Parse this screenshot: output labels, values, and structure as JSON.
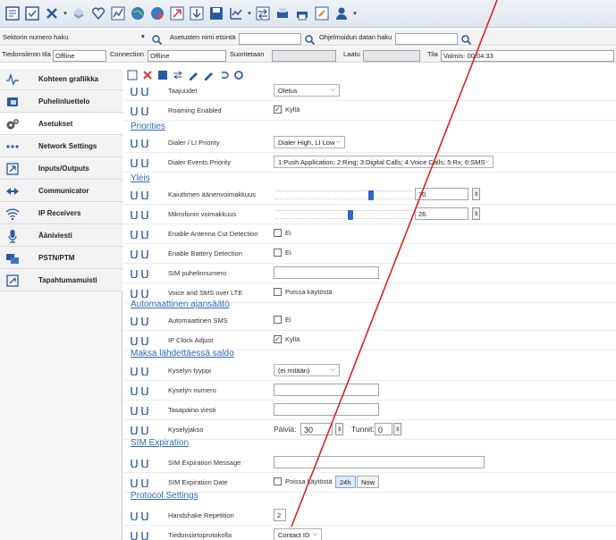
{
  "filters": {
    "sector_label": "Sektorin numero haku",
    "settings_name_label": "Asetusten nimi etsintä",
    "firmware_label": "Ohjelmoidun datan haku",
    "transfer_label": "Tiedonsiirron tila",
    "transfer_value": "Offline",
    "connection_label": "Connection",
    "connection_value": "Offline",
    "executed_label": "Suoritetaan",
    "quality_label": "Laatu",
    "state_label": "Tila",
    "state_value": "Valmis- 00:04:33"
  },
  "sidebar": {
    "items": [
      {
        "label": "Kohteen grafiikka",
        "icon": "graph-icon"
      },
      {
        "label": "Puhelinluettelo",
        "icon": "phonebook-icon"
      },
      {
        "label": "Asetukset",
        "icon": "gears-icon"
      },
      {
        "label": "Network Settings",
        "icon": "network-icon"
      },
      {
        "label": "Inputs/Outputs",
        "icon": "io-icon"
      },
      {
        "label": "Communicator",
        "icon": "communicator-icon"
      },
      {
        "label": "IP Receivers",
        "icon": "wifi-icon"
      },
      {
        "label": "Ääniviesti",
        "icon": "microphone-icon"
      },
      {
        "label": "PSTN/PTM",
        "icon": "pstn-icon"
      },
      {
        "label": "Tapahtumamuisti",
        "icon": "event-log-icon"
      }
    ]
  },
  "params": {
    "freq_label": "Taajuudet",
    "freq_value": "Oletus",
    "roaming_label": "Roaming Enabled",
    "roaming_value": "Kyllä",
    "priorities_head": "Priorities",
    "dialer_label": "Dialer / LI Priority",
    "dialer_value": "Dialer High, LI Low",
    "events_label": "Dialer Events Priority",
    "events_value": "1:Push Application; 2:Ring; 3:Digital Calls; 4:Voice Calls; 5:Rx; 6:SMS",
    "general_head": "Yleis",
    "speaker_label": "Kaiuttimen äänenvoimakkuus",
    "speaker_value": "70",
    "speaker_level": 70,
    "mic_label": "Mikrofonin voimakkuus",
    "mic_value": "26",
    "mic_level": 55,
    "antenna_label": "Enable Antenna Cut Detection",
    "antenna_value": "Ei",
    "battery_label": "Enable Battery Detection",
    "battery_value": "Ei",
    "sim_phone_label": "SIM puhelinnumero",
    "lte_label": "Voice and SMS over LTE",
    "lte_value": "Poissa käytöstä",
    "auto_head": "Automaattinen ajansäätö",
    "auto_sms_label": "Automaattinen SMS",
    "auto_sms_value": "Ei",
    "ipclock_label": "IP Clock Adjust",
    "ipclock_value": "Kyllä",
    "balance_head": "Maksa lähdettäessä saldo",
    "query_type_label": "Kyselyn tyyppi",
    "query_type_value": "(ei mitään)",
    "query_number_label": "Kyselyn numero",
    "balance_msg_label": "Tasapaino viesti",
    "period_label": "Kyselyjakso",
    "days_label": "Päiviä:",
    "days_value": "30",
    "hours_label": "Tunnit:",
    "hours_value": "0",
    "sim_exp_head": "SIM Expiration",
    "sim_msg_label": "SIM Expiration Message",
    "sim_date_label": "SIM Expiration Date",
    "sim_date_value": "Poissa käytöstä",
    "btn_24h": "24h",
    "btn_now": "Now",
    "protocol_head": "Protocol Settings",
    "handshake_label": "Handshake Repetition",
    "handshake_value": "2",
    "protocol_label": "Tiedonsiirtoprotokolla",
    "protocol_value": "Contact ID"
  },
  "colors": {
    "section_head": "#2e6bb5",
    "slider_thumb": "#2c68c6",
    "annotation": "#e0201e"
  }
}
